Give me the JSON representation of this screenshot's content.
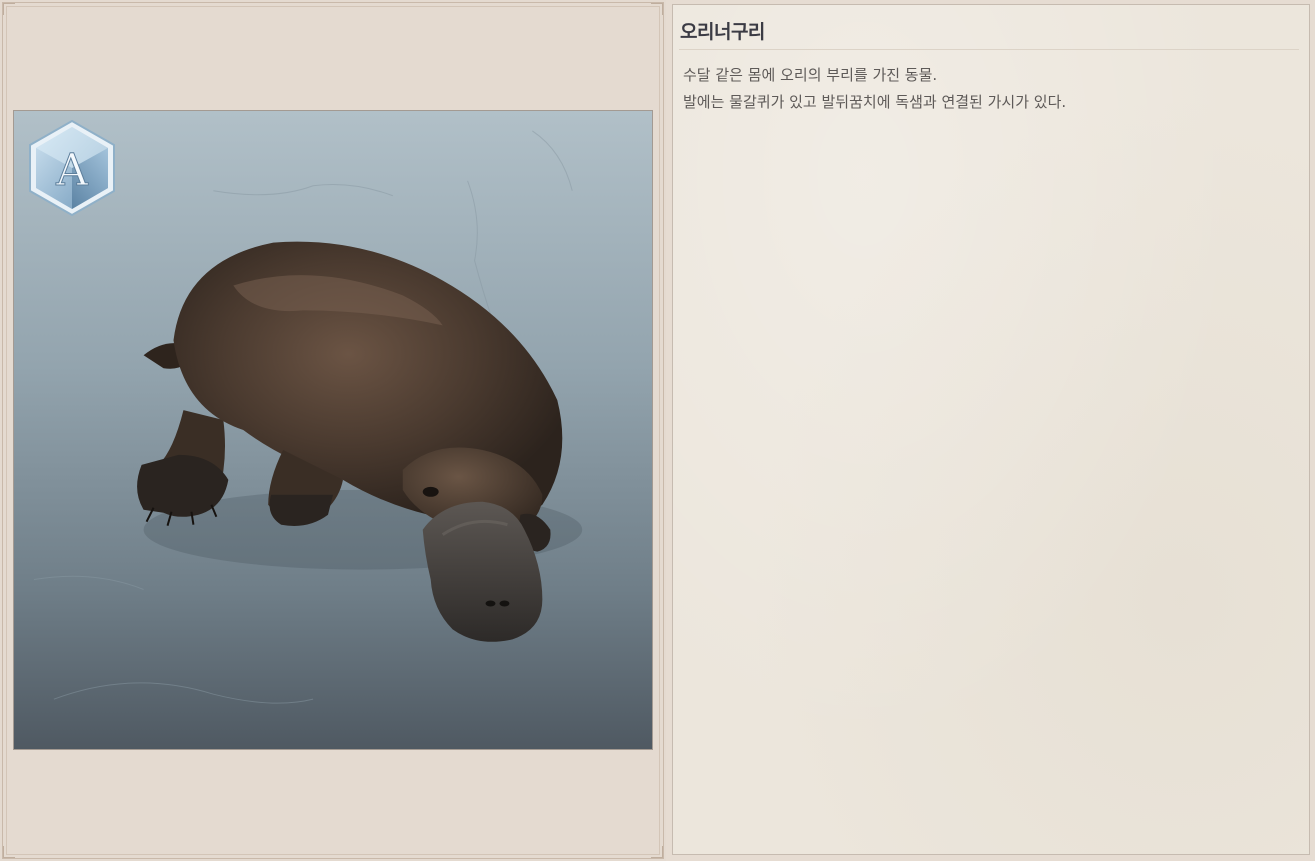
{
  "item": {
    "name": "오리너구리",
    "description": [
      "수달 같은 몸에 오리의 부리를 가진 동물.",
      "발에는 물갈퀴가 있고 발뒤꿈치에 독샘과 연결된 가시가 있다."
    ],
    "grade_letter": "A",
    "image_icon": "platypus-illustration"
  },
  "colors": {
    "panel_bg": "#ece6dc",
    "frame_bg": "#e4dad0",
    "title": "#3b3b44",
    "text": "#5e5a58",
    "badge": "#7fa6c4"
  }
}
